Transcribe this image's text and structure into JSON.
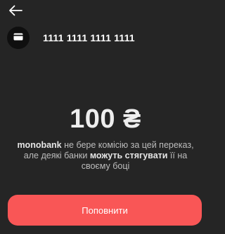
{
  "header": {
    "back_icon": "arrow-left-icon"
  },
  "card": {
    "icon": "credit-card-icon",
    "number": "1111 1111 1111 1111"
  },
  "amount": "100 ₴",
  "notice": {
    "brand": "monobank",
    "text1": " не бере комісію за цей переказ, але деякі банки ",
    "emphasis": "можуть стягувати",
    "text2": " її на своєму боці"
  },
  "action": {
    "label": "Поповнити"
  },
  "colors": {
    "background": "#252525",
    "accent": "#f95656"
  }
}
